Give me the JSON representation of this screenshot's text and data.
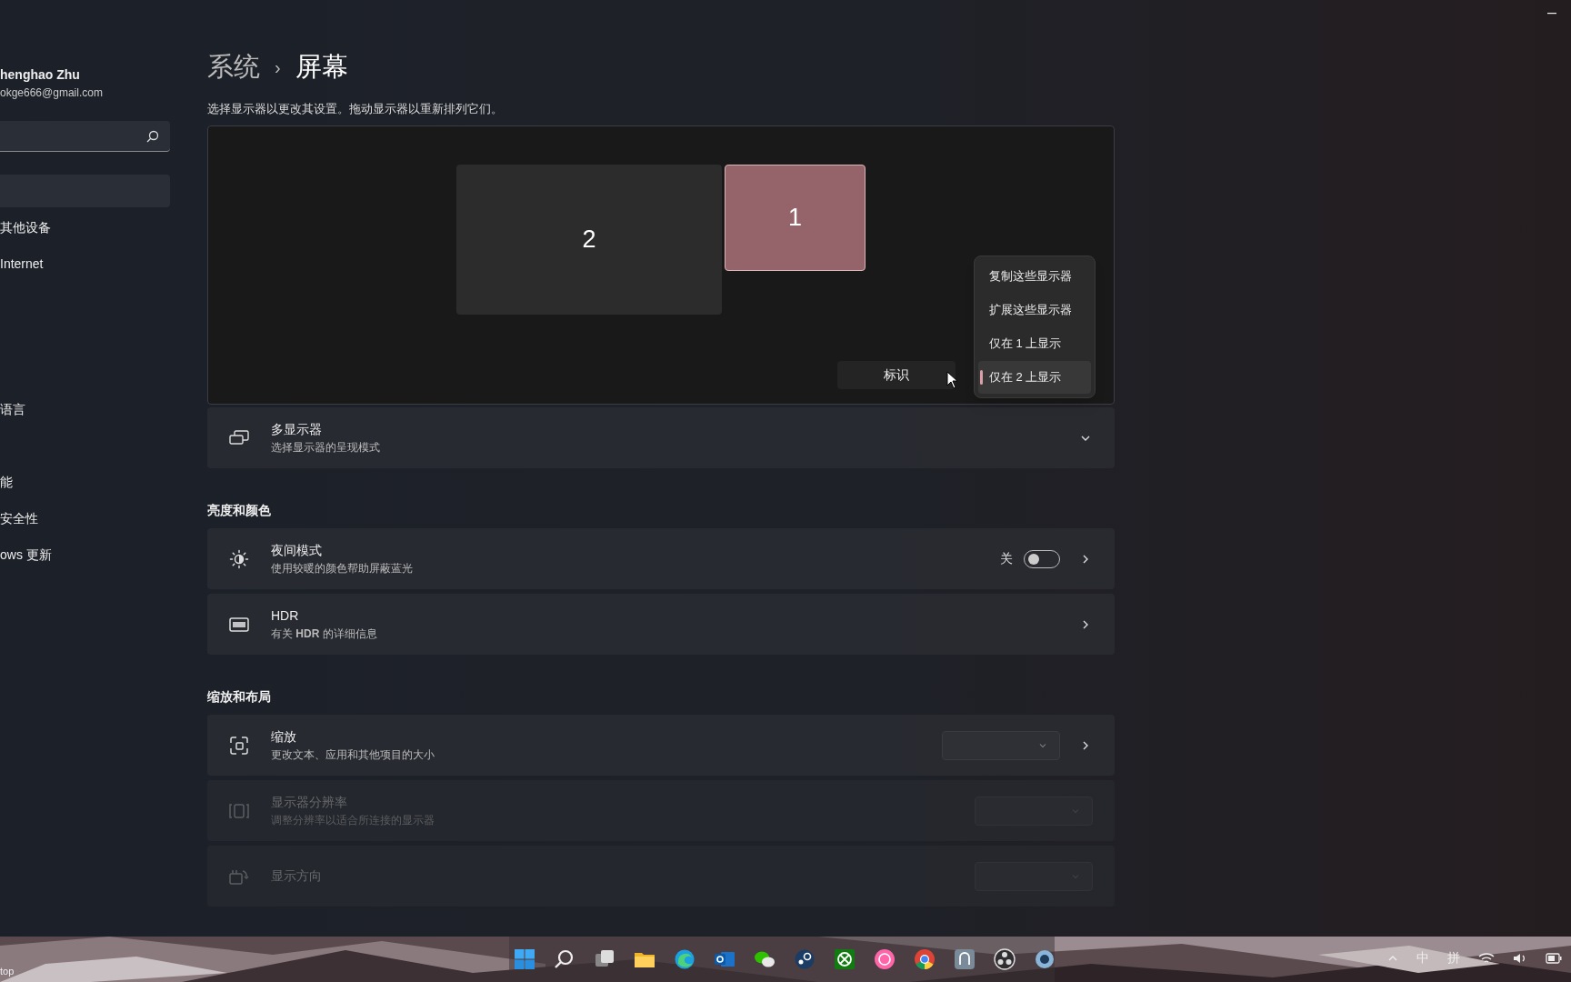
{
  "account": {
    "name": "henghao Zhu",
    "email": "okge666@gmail.com"
  },
  "sidebar": {
    "items": [
      {
        "selected": true
      },
      {
        "label": "其他设备",
        "selected": false
      },
      {
        "label": "Internet",
        "selected": false
      },
      {
        "label": "语言",
        "selected": false
      },
      {
        "label": "能",
        "selected": false
      },
      {
        "label": "安全性",
        "selected": false
      },
      {
        "label": "ows 更新",
        "selected": false
      }
    ]
  },
  "breadcrumb": {
    "parent": "系统",
    "separator": "›",
    "current": "屏幕"
  },
  "instructions": "选择显示器以更改其设置。拖动显示器以重新排列它们。",
  "monitors": [
    {
      "label": "2",
      "selected": false
    },
    {
      "label": "1",
      "selected": true
    }
  ],
  "identify_button": "标识",
  "display_menu": [
    {
      "label": "复制这些显示器",
      "selected": false
    },
    {
      "label": "扩展这些显示器",
      "selected": false
    },
    {
      "label": "仅在 1 上显示",
      "selected": false
    },
    {
      "label": "仅在 2 上显示",
      "selected": true
    }
  ],
  "multi_display": {
    "title": "多显示器",
    "subtitle": "选择显示器的呈现模式",
    "expanded": false
  },
  "sections": [
    {
      "heading": "亮度和颜色",
      "rows": [
        {
          "kind": "night_light",
          "title": "夜间模式",
          "subtitle": "使用较暖的颜色帮助屏蔽蓝光",
          "state_label": "关",
          "on": false,
          "disabled": false
        },
        {
          "kind": "hdr",
          "title": "HDR",
          "subtitle": "有关 **HDR** 的详细信息",
          "disabled": false
        }
      ]
    },
    {
      "heading": "缩放和布局",
      "rows": [
        {
          "kind": "scale",
          "title": "缩放",
          "subtitle": "更改文本、应用和其他项目的大小",
          "disabled": false
        },
        {
          "kind": "resolution",
          "title": "显示器分辨率",
          "subtitle": "调整分辨率以适合所连接的显示器",
          "disabled": true
        },
        {
          "kind": "orientation",
          "title": "显示方向",
          "disabled": true
        }
      ]
    }
  ],
  "taskbar": {
    "left_text": "top",
    "input_mode": "中",
    "ime": "拼"
  }
}
